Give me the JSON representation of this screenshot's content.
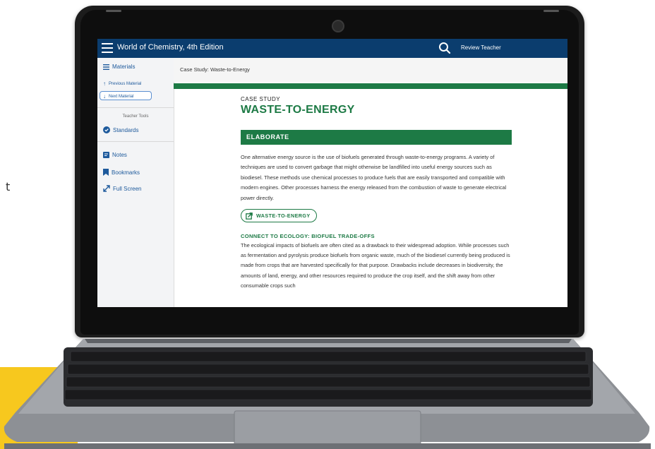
{
  "stray_glyph": "t",
  "app": {
    "title": "World of Chemistry, 4th Edition",
    "user": "Review Teacher",
    "icons": {
      "menu": "menu-icon",
      "search": "search-icon"
    }
  },
  "sidebar": {
    "materials": "Materials",
    "previous": "Previous Material",
    "next": "Next Material",
    "tools_label": "Teacher Tools",
    "standards": "Standards",
    "notes": "Notes",
    "bookmarks": "Bookmarks",
    "fullscreen": "Full Screen"
  },
  "breadcrumb": "Case Study: Waste-to-Energy",
  "content": {
    "kicker": "CASE STUDY",
    "heading": "WASTE-TO-ENERGY",
    "section": "ELABORATE",
    "paragraph1": "One alternative energy source is the use of biofuels generated through waste-to-energy programs. A variety of techniques are used to convert garbage that might otherwise be landfilled into useful energy sources such as biodiesel. These methods use chemical processes to produce fuels that are easily transported and compatible with modern engines. Other processes harness the energy released from the combustion of waste to generate electrical power directly.",
    "link_label": "WASTE-TO-ENERGY",
    "subheading": "CONNECT TO ECOLOGY: BIOFUEL TRADE-OFFS",
    "paragraph2": "The ecological impacts of biofuels are often cited as a drawback to their widespread adoption. While processes such as fermentation and pyrolysis produce biofuels from organic waste, much of the biodiesel currently being produced is made from crops that are harvested specifically for that purpose. Drawbacks include decreases in biodiversity, the amounts of land, energy, and other resources required to produce the crop itself, and the shift away from other consumable crops such"
  },
  "colors": {
    "topbar": "#0b3d6e",
    "accent_green": "#1d7a45",
    "link_blue": "#1e5a9c",
    "yellow_block": "#f7c81e"
  }
}
